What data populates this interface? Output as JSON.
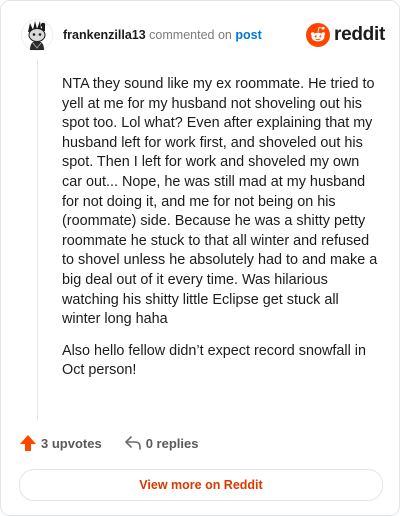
{
  "header": {
    "username": "frankenzilla13",
    "commented_on": "commented on",
    "post_link": "post",
    "brand_name": "reddit",
    "brand_icon": "reddit-snoo-icon"
  },
  "comment": {
    "paragraphs": [
      "NTA they sound like my ex roommate. He tried to yell at me for my husband not shoveling out his spot too. Lol what? Even after explaining that my husband left for work first, and shoveled out his spot. Then I left for work and shoveled my own car out... Nope, he was still mad at my husband for not doing it, and me for not being on his (roommate) side. Because he was a shitty petty roommate he stuck to that all winter and refused to shovel unless he absolutely had to and make a big deal out of it every time. Was hilarious watching his shitty little Eclipse get stuck all winter long haha",
      "Also hello fellow didn’t expect record snowfall in Oct person!"
    ]
  },
  "actions": {
    "upvotes_label": "3 upvotes",
    "replies_label": "0 replies",
    "upvote_icon": "upvote-arrow-icon",
    "reply_icon": "reply-arrow-icon"
  },
  "footer": {
    "view_more_label": "View more on Reddit"
  },
  "colors": {
    "brand": "#ff4500",
    "link": "#0079d3",
    "view_more": "#d93a00"
  }
}
